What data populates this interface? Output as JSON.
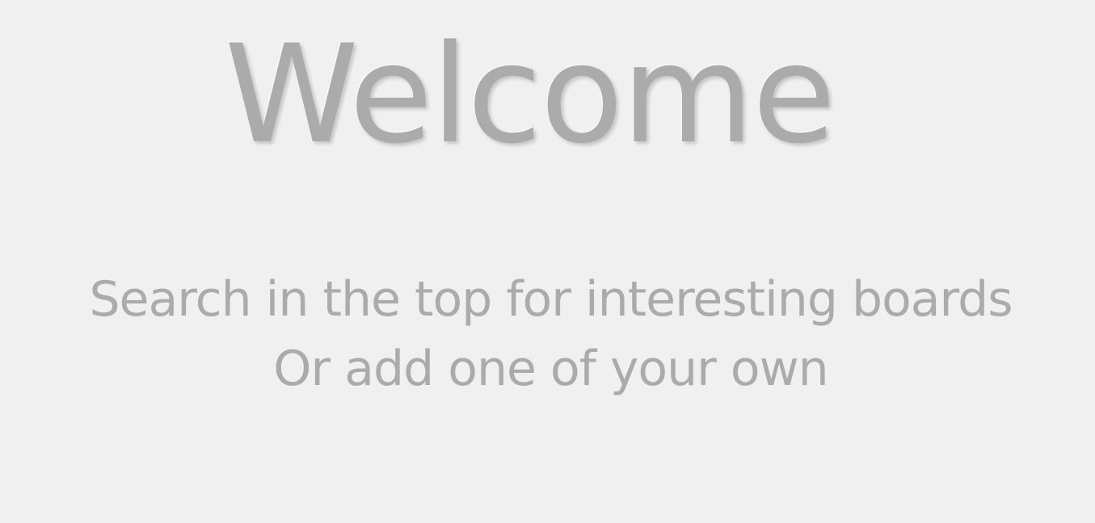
{
  "welcome": {
    "title": "Welcome",
    "subtitle_line1": "Search in the top  for interesting boards",
    "subtitle_line2": "Or add one of your own"
  },
  "colors": {
    "background": "#f0f0f0",
    "text": "#ababab"
  }
}
